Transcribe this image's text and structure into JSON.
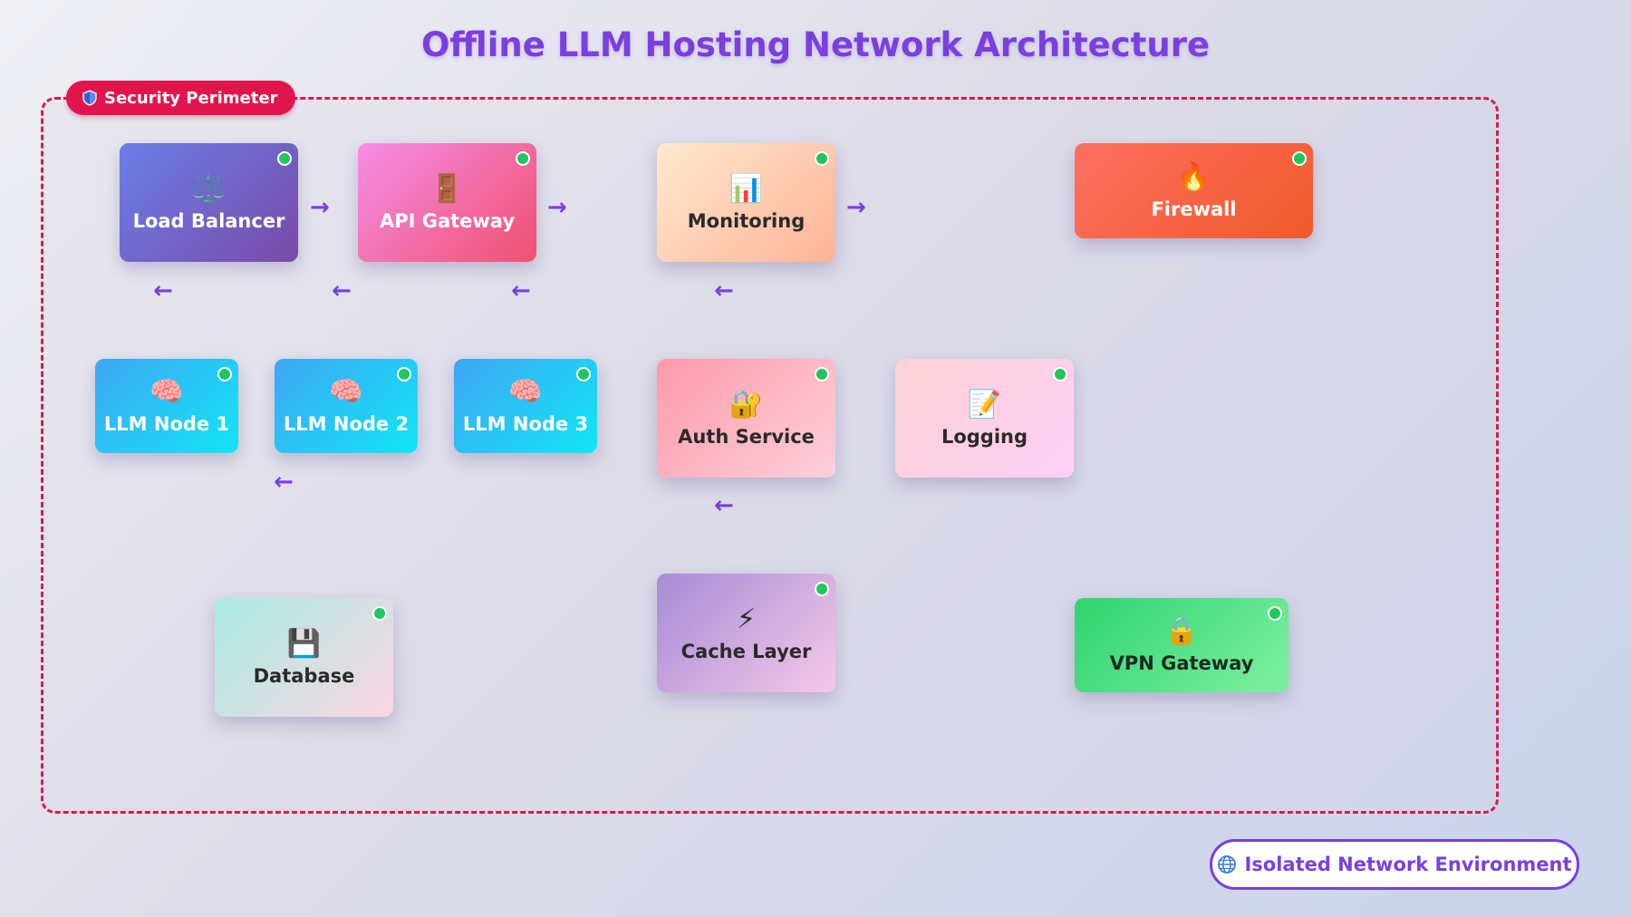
{
  "title": "Offline LLM Hosting Network Architecture",
  "perimeter": {
    "label": "Security Perimeter",
    "icon": "shield-icon",
    "color": "#e0154c"
  },
  "nodes": {
    "load_balancer": {
      "label": "Load Balancer",
      "icon": "⚖️",
      "status": "online"
    },
    "api_gateway": {
      "label": "API Gateway",
      "icon": "🚪",
      "status": "online"
    },
    "monitoring": {
      "label": "Monitoring",
      "icon": "📊",
      "status": "online"
    },
    "firewall": {
      "label": "Firewall",
      "icon": "🔥",
      "status": "online"
    },
    "llm_node_1": {
      "label": "LLM Node 1",
      "icon": "🧠",
      "status": "online"
    },
    "llm_node_2": {
      "label": "LLM Node 2",
      "icon": "🧠",
      "status": "online"
    },
    "llm_node_3": {
      "label": "LLM Node 3",
      "icon": "🧠",
      "status": "online"
    },
    "auth_service": {
      "label": "Auth Service",
      "icon": "🔐",
      "status": "online"
    },
    "logging": {
      "label": "Logging",
      "icon": "📝",
      "status": "online"
    },
    "database": {
      "label": "Database",
      "icon": "💾",
      "status": "online"
    },
    "cache_layer": {
      "label": "Cache Layer",
      "icon": "⚡",
      "status": "online"
    },
    "vpn_gateway": {
      "label": "VPN Gateway",
      "icon": "🔒",
      "status": "online"
    }
  },
  "arrows": {
    "right": "→",
    "left": "←"
  },
  "environment": {
    "label": "Isolated Network Environment",
    "icon": "globe-icon"
  },
  "colors": {
    "accent": "#7b3fe0",
    "status_online": "#22c55e",
    "perimeter": "#d81b4a"
  }
}
